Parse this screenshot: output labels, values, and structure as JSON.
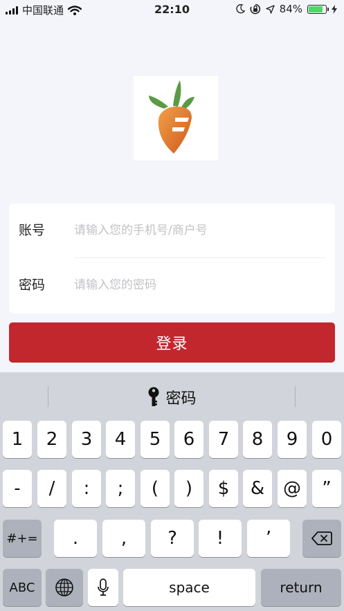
{
  "status_bar": {
    "carrier": "中国联通",
    "time": "22:10",
    "battery": "84%",
    "battery_level": 0.84
  },
  "form": {
    "account_label": "账号",
    "account_placeholder": "请输入您的手机号/商户号",
    "password_label": "密码",
    "password_placeholder": "请输入您的密码"
  },
  "login_button": "登录",
  "keyboard": {
    "suggestion": "密码",
    "row1": [
      "1",
      "2",
      "3",
      "4",
      "5",
      "6",
      "7",
      "8",
      "9",
      "0"
    ],
    "row2": [
      "-",
      "/",
      ":",
      ";",
      "(",
      ")",
      "$",
      "&",
      "@",
      "”"
    ],
    "row3_shift": "#+=",
    "row3": [
      ".",
      ",",
      "?",
      "!",
      "’"
    ],
    "abc": "ABC",
    "space": "space",
    "return": "return"
  },
  "colors": {
    "primary": "#c1272d",
    "background": "#f3f5fa",
    "battery": "#4cd964"
  },
  "icons": {
    "app_logo": "carrot-logo-icon",
    "wifi": "wifi-icon",
    "moon": "moon-icon",
    "lock_rotation": "orientation-lock-icon",
    "location": "location-arrow-icon",
    "charging": "charging-bolt-icon",
    "key": "key-icon",
    "delete": "backspace-icon",
    "globe": "globe-icon",
    "mic": "microphone-icon"
  }
}
